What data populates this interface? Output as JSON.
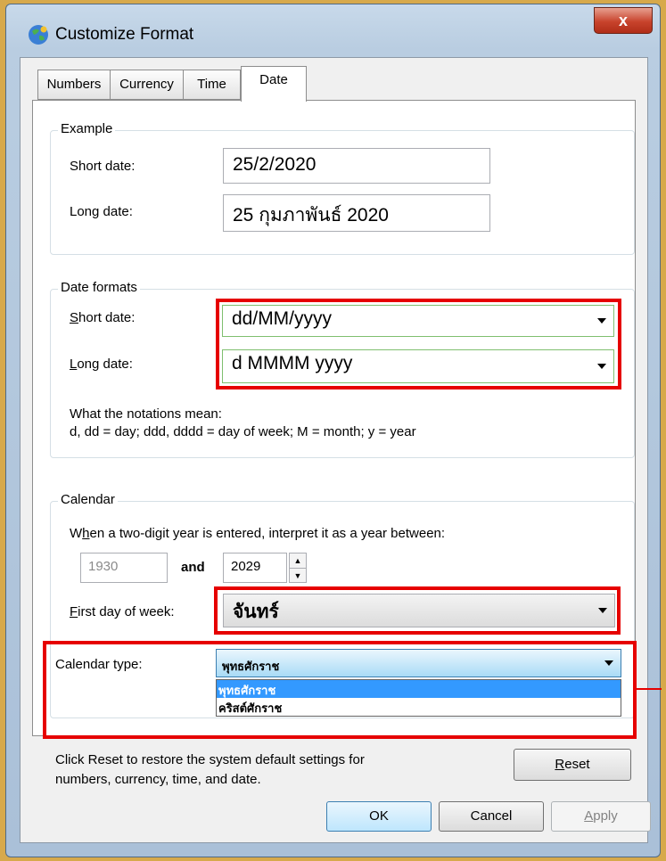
{
  "window": {
    "title": "Customize Format",
    "close_label": "x"
  },
  "tabs": [
    {
      "label": "Numbers"
    },
    {
      "label": "Currency"
    },
    {
      "label": "Time"
    },
    {
      "label": "Date"
    }
  ],
  "example": {
    "title": "Example",
    "short_label": "Short date:",
    "short_value": "25/2/2020",
    "long_label": "Long date:",
    "long_value": "25 กุมภาพันธ์ 2020"
  },
  "formats": {
    "title": "Date formats",
    "short_label_u": "S",
    "short_label_rest": "hort date:",
    "short_value": "dd/MM/yyyy",
    "long_label_u": "L",
    "long_label_rest": "ong date:",
    "long_value": "d MMMM yyyy",
    "notation_line1": "What the notations mean:",
    "notation_line2": "d, dd = day;  ddd, dddd = day of week;  M = month;  y = year"
  },
  "calendar": {
    "title": "Calendar",
    "twodigit_pre": "W",
    "twodigit_u": "h",
    "twodigit_post": "en a two-digit year is entered, interpret it as a year between:",
    "year_start": "1930",
    "and_label": "and",
    "year_end": "2029",
    "first_day_u": "F",
    "first_day_rest": "irst day of week:",
    "first_day_value": "จันทร์",
    "type_label": "Calendar type:",
    "type_value": "พุทธศักราช",
    "type_options": [
      "พุทธศักราช",
      "คริสต์ศักราช"
    ]
  },
  "reset": {
    "line1": "Click Reset to restore the system default settings for",
    "line2": "numbers, currency, time, and date.",
    "button_u": "R",
    "button_rest": "eset"
  },
  "buttons": {
    "ok": "OK",
    "cancel": "Cancel",
    "apply_u": "A",
    "apply_rest": "pply"
  }
}
